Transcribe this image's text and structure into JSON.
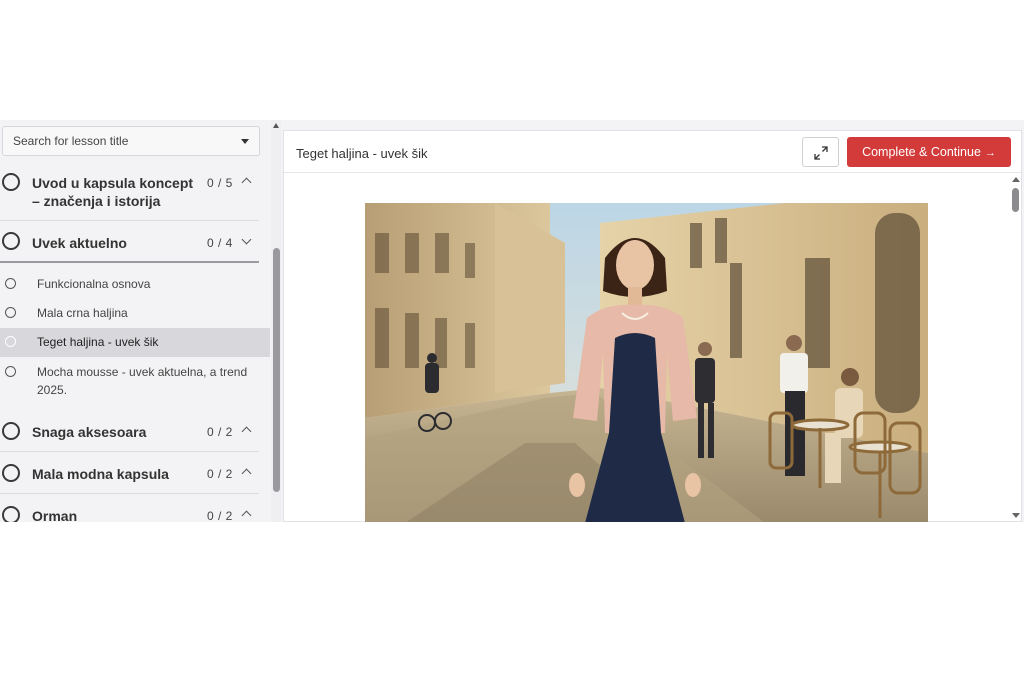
{
  "sidebar": {
    "search": {
      "placeholder": "Search for lesson title"
    },
    "sections": [
      {
        "title": "Uvod u kapsula koncept – značenja i istorija",
        "count": "0 / 5",
        "expanded": false
      },
      {
        "title": "Uvek aktuelno",
        "count": "0 / 4",
        "expanded": true
      },
      {
        "title": "Snaga aksesoara",
        "count": "0 / 2",
        "expanded": false
      },
      {
        "title": "Mala modna kapsula",
        "count": "0 / 2",
        "expanded": false
      },
      {
        "title": "Orman",
        "count": "0 / 2",
        "expanded": false
      }
    ],
    "lessons": [
      {
        "label": "Funkcionalna osnova"
      },
      {
        "label": "Mala crna haljina"
      },
      {
        "label": "Teget haljina - uvek šik",
        "active": true
      },
      {
        "label": "Mocha mousse - uvek aktuelna, a trend 2025."
      }
    ]
  },
  "main": {
    "lesson_title": "Teget haljina - uvek šik",
    "complete_label": "Complete & Continue",
    "complete_arrow": "→",
    "accent_color": "#d33a3a"
  },
  "icons": {
    "expand": "expand-icon",
    "search_dropdown": "caret-down-icon",
    "section_status": "circle-icon",
    "chevron": "chevron-icon"
  }
}
